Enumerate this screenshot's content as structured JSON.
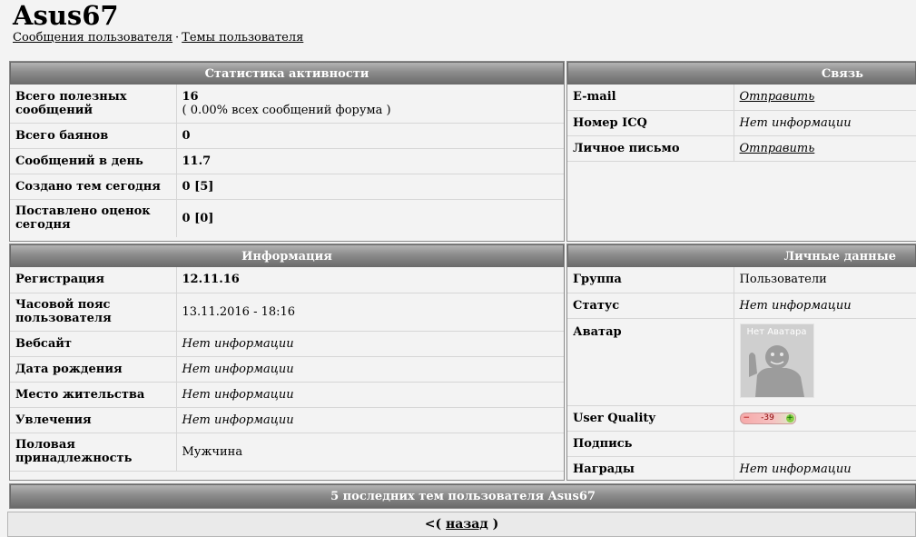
{
  "user": {
    "name": "Asus67",
    "nav": {
      "messages": "Сообщения пользователя",
      "separator": "·",
      "topics": "Темы пользователя"
    }
  },
  "activity": {
    "title": "Статистика активности",
    "rows": [
      {
        "label": "Всего полезных сообщений",
        "value": "16",
        "note": "( 0.00% всех сообщений форума )"
      },
      {
        "label": "Всего баянов",
        "value": "0"
      },
      {
        "label": "Сообщений в день",
        "value": "11.7"
      },
      {
        "label": "Создано тем сегодня",
        "value": "0 [5]"
      },
      {
        "label": "Поставлено оценок сегодня",
        "value": "0 [0]"
      }
    ]
  },
  "contact": {
    "title": "Связь",
    "rows": [
      {
        "label": "E-mail",
        "value": "Отправить"
      },
      {
        "label": "Номер ICQ",
        "value": "Нет информации"
      },
      {
        "label": "Личное письмо",
        "value": "Отправить"
      }
    ]
  },
  "info": {
    "title": "Информация",
    "rows": [
      {
        "label": "Регистрация",
        "value": "12.11.16"
      },
      {
        "label": "Часовой пояс пользователя",
        "value": "13.11.2016 - 18:16"
      },
      {
        "label": "Вебсайт",
        "value": "Нет информации"
      },
      {
        "label": "Дата рождения",
        "value": "Нет информации"
      },
      {
        "label": "Место жительства",
        "value": "Нет информации"
      },
      {
        "label": "Увлечения",
        "value": "Нет информации"
      },
      {
        "label": "Половая принадлежность",
        "value": "Мужчина"
      }
    ]
  },
  "personal": {
    "title": "Личные данные",
    "rows": [
      {
        "label": "Группа",
        "value": "Пользователи"
      },
      {
        "label": "Статус",
        "value": "Нет информации"
      },
      {
        "label": "Аватар",
        "avatar_text": "Нет Аватара"
      },
      {
        "label": "User Quality",
        "minus": "−",
        "quality": "-39",
        "plus": "+"
      },
      {
        "label": "Подпись",
        "value": ""
      },
      {
        "label": "Награды",
        "value": "Нет информации"
      }
    ]
  },
  "recent": {
    "title": "5 последних тем пользователя Asus67"
  },
  "back": {
    "prefix": "<(",
    "link": "назад",
    "suffix": ")"
  }
}
